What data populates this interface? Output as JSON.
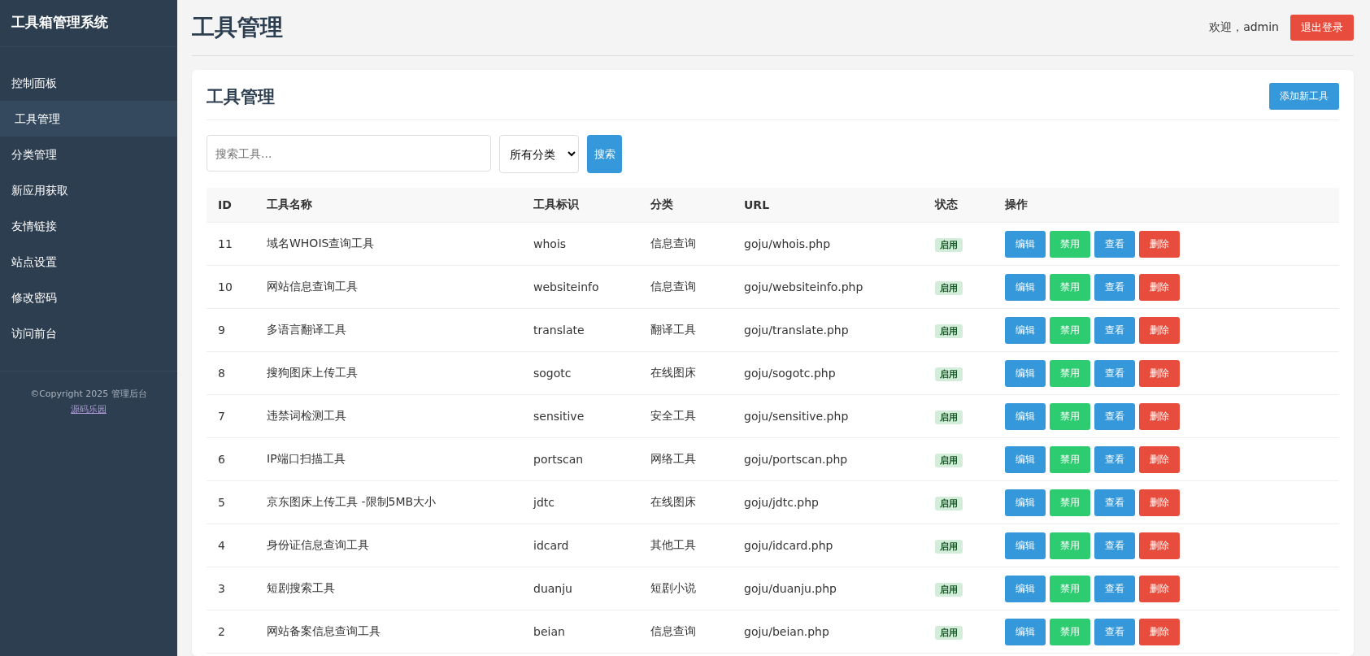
{
  "sidebar": {
    "title": "工具箱管理系统",
    "items": [
      {
        "label": "控制面板",
        "selected": false
      },
      {
        "label": "工具管理",
        "selected": true
      },
      {
        "label": "分类管理",
        "selected": false
      },
      {
        "label": "新应用获取",
        "selected": false
      },
      {
        "label": "友情链接",
        "selected": false
      },
      {
        "label": "站点设置",
        "selected": false
      },
      {
        "label": "修改密码",
        "selected": false
      },
      {
        "label": "访问前台",
        "selected": false
      }
    ],
    "copyright": "©Copyright 2025 管理后台",
    "footer_link": "源码乐园"
  },
  "header": {
    "title": "工具管理",
    "welcome": "欢迎，admin",
    "logout": "退出登录"
  },
  "card": {
    "title": "工具管理",
    "add_button": "添加新工具",
    "search": {
      "placeholder": "搜索工具...",
      "category": "所有分类",
      "button": "搜索"
    },
    "table": {
      "columns": [
        "ID",
        "工具名称",
        "工具标识",
        "分类",
        "URL",
        "状态",
        "操作"
      ],
      "rows": [
        {
          "id": "11",
          "name": "域名WHOIS查询工具",
          "slug": "whois",
          "category": "信息查询",
          "url": "goju/whois.php",
          "status": "启用",
          "enabled": true,
          "actions": [
            {
              "label": "编辑",
              "kind": "edit"
            },
            {
              "label": "禁用",
              "kind": "toggle"
            },
            {
              "label": "查看",
              "kind": "view"
            },
            {
              "label": "删除",
              "kind": "delete"
            }
          ]
        },
        {
          "id": "10",
          "name": "网站信息查询工具",
          "slug": "websiteinfo",
          "category": "信息查询",
          "url": "goju/websiteinfo.php",
          "status": "启用",
          "enabled": true,
          "actions": [
            {
              "label": "编辑",
              "kind": "edit"
            },
            {
              "label": "禁用",
              "kind": "toggle"
            },
            {
              "label": "查看",
              "kind": "view"
            },
            {
              "label": "删除",
              "kind": "delete"
            }
          ]
        },
        {
          "id": "9",
          "name": "多语言翻译工具",
          "slug": "translate",
          "category": "翻译工具",
          "url": "goju/translate.php",
          "status": "启用",
          "enabled": true,
          "actions": [
            {
              "label": "编辑",
              "kind": "edit"
            },
            {
              "label": "禁用",
              "kind": "toggle"
            },
            {
              "label": "查看",
              "kind": "view"
            },
            {
              "label": "删除",
              "kind": "delete"
            }
          ]
        },
        {
          "id": "8",
          "name": "搜狗图床上传工具",
          "slug": "sogotc",
          "category": "在线图床",
          "url": "goju/sogotc.php",
          "status": "启用",
          "enabled": true,
          "actions": [
            {
              "label": "编辑",
              "kind": "edit"
            },
            {
              "label": "禁用",
              "kind": "toggle"
            },
            {
              "label": "查看",
              "kind": "view"
            },
            {
              "label": "删除",
              "kind": "delete"
            }
          ]
        },
        {
          "id": "7",
          "name": "违禁词检测工具",
          "slug": "sensitive",
          "category": "安全工具",
          "url": "goju/sensitive.php",
          "status": "启用",
          "enabled": true,
          "actions": [
            {
              "label": "编辑",
              "kind": "edit"
            },
            {
              "label": "禁用",
              "kind": "toggle"
            },
            {
              "label": "查看",
              "kind": "view"
            },
            {
              "label": "删除",
              "kind": "delete"
            }
          ]
        },
        {
          "id": "6",
          "name": "IP端口扫描工具",
          "slug": "portscan",
          "category": "网络工具",
          "url": "goju/portscan.php",
          "status": "启用",
          "enabled": true,
          "actions": [
            {
              "label": "编辑",
              "kind": "edit"
            },
            {
              "label": "禁用",
              "kind": "toggle"
            },
            {
              "label": "查看",
              "kind": "view"
            },
            {
              "label": "删除",
              "kind": "delete"
            }
          ]
        },
        {
          "id": "5",
          "name": "京东图床上传工具 -限制5MB大小",
          "slug": "jdtc",
          "category": "在线图床",
          "url": "goju/jdtc.php",
          "status": "启用",
          "enabled": true,
          "actions": [
            {
              "label": "编辑",
              "kind": "edit"
            },
            {
              "label": "禁用",
              "kind": "toggle"
            },
            {
              "label": "查看",
              "kind": "view"
            },
            {
              "label": "删除",
              "kind": "delete"
            }
          ]
        },
        {
          "id": "4",
          "name": "身份证信息查询工具",
          "slug": "idcard",
          "category": "其他工具",
          "url": "goju/idcard.php",
          "status": "启用",
          "enabled": true,
          "actions": [
            {
              "label": "编辑",
              "kind": "edit"
            },
            {
              "label": "禁用",
              "kind": "toggle"
            },
            {
              "label": "查看",
              "kind": "view"
            },
            {
              "label": "删除",
              "kind": "delete"
            }
          ]
        },
        {
          "id": "3",
          "name": "短剧搜索工具",
          "slug": "duanju",
          "category": "短剧小说",
          "url": "goju/duanju.php",
          "status": "启用",
          "enabled": true,
          "actions": [
            {
              "label": "编辑",
              "kind": "edit"
            },
            {
              "label": "禁用",
              "kind": "toggle"
            },
            {
              "label": "查看",
              "kind": "view"
            },
            {
              "label": "删除",
              "kind": "delete"
            }
          ]
        },
        {
          "id": "2",
          "name": "网站备案信息查询工具",
          "slug": "beian",
          "category": "信息查询",
          "url": "goju/beian.php",
          "status": "启用",
          "enabled": true,
          "actions": [
            {
              "label": "编辑",
              "kind": "edit"
            },
            {
              "label": "禁用",
              "kind": "toggle"
            },
            {
              "label": "查看",
              "kind": "view"
            },
            {
              "label": "删除",
              "kind": "delete"
            }
          ]
        }
      ]
    }
  }
}
